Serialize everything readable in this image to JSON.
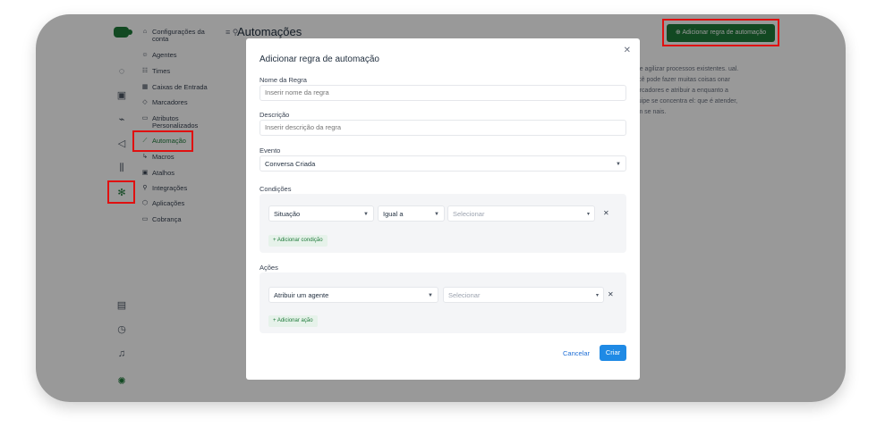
{
  "header": {
    "title": "Automações",
    "add_rule_label": "Adicionar regra de automação"
  },
  "background_text": "uir e agilizar processos existentes. ual. Você pode fazer muitas coisas onar marcadores e atribuir a enquanto a equipe se concentra el: que é atender, sem se nais.",
  "sidebar": {
    "items": [
      {
        "label": "Configurações da conta",
        "icon": "home-icon"
      },
      {
        "label": "Agentes",
        "icon": "users-icon"
      },
      {
        "label": "Times",
        "icon": "team-icon"
      },
      {
        "label": "Caixas de Entrada",
        "icon": "inbox-icon"
      },
      {
        "label": "Marcadores",
        "icon": "tag-icon"
      },
      {
        "label": "Atributos Personalizados",
        "icon": "attribute-icon"
      },
      {
        "label": "Automação",
        "icon": "automation-icon"
      },
      {
        "label": "Macros",
        "icon": "macro-icon"
      },
      {
        "label": "Atalhos",
        "icon": "shortcut-icon"
      },
      {
        "label": "Integrações",
        "icon": "plug-icon"
      },
      {
        "label": "Aplicações",
        "icon": "app-icon"
      },
      {
        "label": "Cobrança",
        "icon": "billing-icon"
      }
    ]
  },
  "modal": {
    "title": "Adicionar regra de automação",
    "name_label": "Nome da Regra",
    "name_placeholder": "Inserir nome da regra",
    "description_label": "Descrição",
    "description_placeholder": "Inserir descrição da regra",
    "event_label": "Evento",
    "event_value": "Conversa Criada",
    "conditions_label": "Condições",
    "condition": {
      "attribute": "Situação",
      "operator": "Igual a",
      "value_placeholder": "Selecionar"
    },
    "add_condition_label": "Adicionar condição",
    "actions_label": "Ações",
    "action": {
      "type": "Atribuir um agente",
      "value_placeholder": "Selecionar"
    },
    "add_action_label": "Adicionar ação",
    "cancel_label": "Cancelar",
    "create_label": "Criar"
  },
  "colors": {
    "accent": "#1f7a3a",
    "highlight": "#e01010",
    "primary_button": "#1f8ae5"
  }
}
